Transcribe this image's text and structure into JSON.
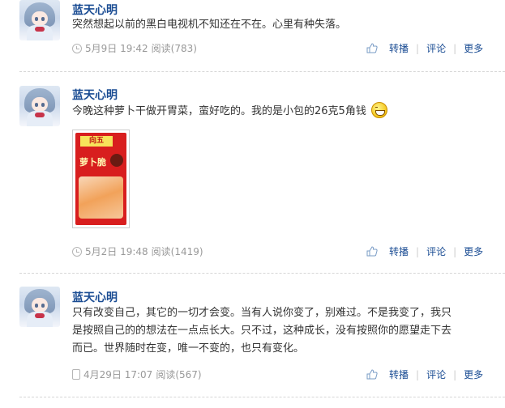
{
  "posts": [
    {
      "author": "蓝天心明",
      "text": "突然想起以前的黑白电视机不知还在不在。心里有种失落。",
      "meta_icon": "clock-icon",
      "date": "5月9日 19:42",
      "reads": "阅读(783)"
    },
    {
      "author": "蓝天心明",
      "text": "今晚这种萝卜干做开胃菜，蛮好吃的。我的是小包的26克5角钱",
      "emoji": "grin-emoji",
      "photo_brand": "向五",
      "photo_title": "萝卜脆",
      "meta_icon": "clock-icon",
      "date": "5月2日 19:48",
      "reads": "阅读(1419)"
    },
    {
      "author": "蓝天心明",
      "text_lines": [
        "只有改变自己，其它的一切才会变。当有人说你变了，别难过。不是我变了，我只",
        "是按照自己的的想法在一点点长大。只不过，这种成长，没有按照你的愿望走下去",
        "而已。世界随时在变，唯一不变的，也只有变化。"
      ],
      "meta_icon": "phone-icon",
      "date": "4月29日 17:07",
      "reads": "阅读(567)"
    }
  ],
  "actions": {
    "repost": "转播",
    "comment": "评论",
    "more": "更多"
  },
  "colors": {
    "link": "#1a4c93",
    "meta": "#999999",
    "divider": "#d6d6d6"
  }
}
